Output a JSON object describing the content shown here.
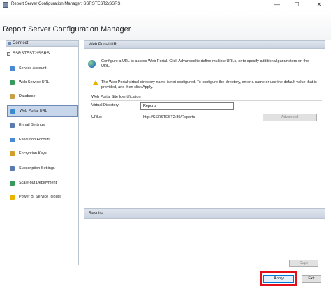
{
  "window": {
    "title": "Report Server Configuration Manager: SSRSTEST2\\SSRS",
    "minimize_glyph": "—",
    "maximize_glyph": "☐",
    "close_glyph": "✕"
  },
  "header": {
    "title": "Report Server Configuration Manager"
  },
  "sidebar": {
    "connect_label": "Connect",
    "server": "SSRSTEST2\\SSRS",
    "items": [
      {
        "label": "Service Account",
        "icon": "service-account-icon",
        "color": "#4a8ad4"
      },
      {
        "label": "Web Service URL",
        "icon": "web-service-icon",
        "color": "#3a9a5b"
      },
      {
        "label": "Database",
        "icon": "database-icon",
        "color": "#c9a04a"
      },
      {
        "label": "Web Portal URL",
        "icon": "web-portal-icon",
        "color": "#3a8ad0",
        "active": true
      },
      {
        "label": "E-mail Settings",
        "icon": "email-icon",
        "color": "#5b7bb3"
      },
      {
        "label": "Execution Account",
        "icon": "execution-account-icon",
        "color": "#4a8ad4"
      },
      {
        "label": "Encryption Keys",
        "icon": "encryption-keys-icon",
        "color": "#d1a02a"
      },
      {
        "label": "Subscription Settings",
        "icon": "subscription-icon",
        "color": "#5b7bb3"
      },
      {
        "label": "Scale-out Deployment",
        "icon": "scale-out-icon",
        "color": "#3a9a5b"
      },
      {
        "label": "Power BI Service (cloud)",
        "icon": "power-bi-icon",
        "color": "#e8b400"
      }
    ]
  },
  "main": {
    "title": "Web Portal URL",
    "intro": "Configure a URL to access Web Portal. Click Advanced to define multiple URLs, or to specify additional parameters on the URL.",
    "warning": "The Web Portal virtual directory name is not configured. To configure the directory, enter a name or use the default value that is provided, and then click Apply.",
    "group_label": "Web Portal Site Identification",
    "virtual_directory_label": "Virtual Directory:",
    "virtual_directory_value": "Reports",
    "urls_label": "URLs:",
    "urls_value": "http://SSRSTEST2:80/Reports",
    "advanced_label": "Advanced"
  },
  "results": {
    "title": "Results",
    "copy_label": "Copy"
  },
  "footer": {
    "apply_label": "Apply",
    "exit_label": "Exit"
  }
}
